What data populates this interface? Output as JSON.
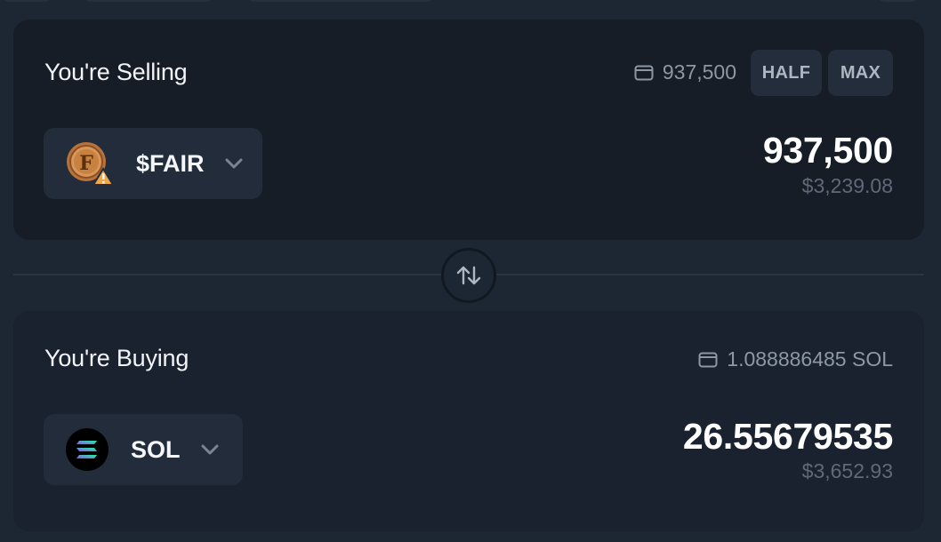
{
  "selling": {
    "title": "You're Selling",
    "balance": "937,500",
    "half_label": "HALF",
    "max_label": "MAX",
    "token": {
      "symbol": "$FAIR",
      "icon": "fair-token-icon"
    },
    "amount": "937,500",
    "usd_value": "$3,239.08"
  },
  "buying": {
    "title": "You're Buying",
    "balance": "1.088886485 SOL",
    "token": {
      "symbol": "SOL",
      "icon": "sol-token-icon"
    },
    "amount": "26.55679535",
    "usd_value": "$3,652.93"
  },
  "colors": {
    "background": "#1d2633",
    "sell_card": "#161d27",
    "buy_card": "#1a2230",
    "warning": "#f0a64c"
  }
}
